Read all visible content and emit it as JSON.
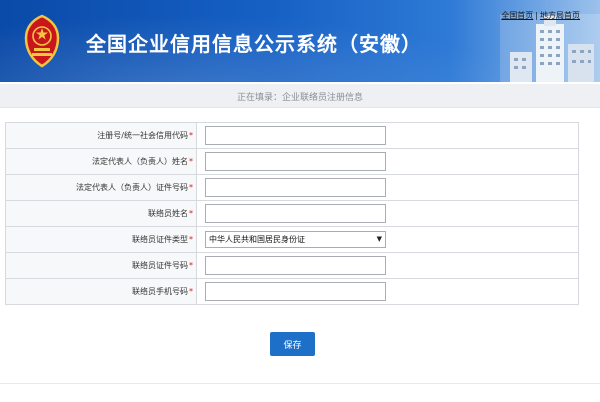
{
  "header": {
    "title": "全国企业信用信息公示系统（安徽）",
    "links": [
      "全国首页",
      "地方局首页"
    ],
    "emblem": "national-emblem-icon",
    "building": "building-photo",
    "colors": {
      "banner_start": "#0a4aa8",
      "banner_end": "#9cc2ec"
    }
  },
  "breadcrumb": "正在填录：企业联络员注册信息",
  "form": {
    "fields": [
      {
        "label": "注册号/统一社会信用代码",
        "required": "*",
        "type": "text",
        "value": ""
      },
      {
        "label": "法定代表人（负责人）姓名",
        "required": "*",
        "type": "text",
        "value": ""
      },
      {
        "label": "法定代表人（负责人）证件号码",
        "required": "*",
        "type": "text",
        "value": ""
      },
      {
        "label": "联络员姓名",
        "required": "*",
        "type": "text",
        "value": ""
      },
      {
        "label": "联络员证件类型",
        "required": "*",
        "type": "select",
        "value": "中华人民共和国居民身份证"
      },
      {
        "label": "联络员证件号码",
        "required": "*",
        "type": "text",
        "value": ""
      },
      {
        "label": "联络员手机号码",
        "required": "*",
        "type": "text",
        "value": ""
      }
    ]
  },
  "save_label": "保存",
  "accent_color": "#1e6fc7"
}
